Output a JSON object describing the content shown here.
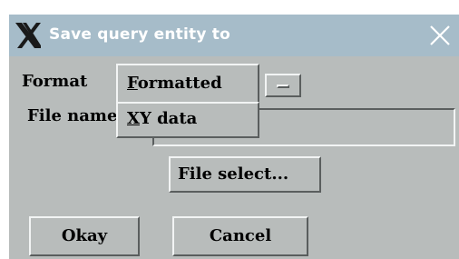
{
  "window": {
    "title": "Save query entity to",
    "logo_icon": "x-window-logo-icon",
    "close_icon": "close-icon"
  },
  "format": {
    "label": "Format",
    "selected": "Formatted",
    "options": [
      "XY data"
    ]
  },
  "file_name": {
    "label": "File name",
    "value": ""
  },
  "buttons": {
    "file_select": "File select...",
    "okay": "Okay",
    "cancel": "Cancel"
  },
  "colors": {
    "titlebar": "#a6bcc9",
    "background": "#b8bcbb",
    "title_text": "#ffffff"
  }
}
